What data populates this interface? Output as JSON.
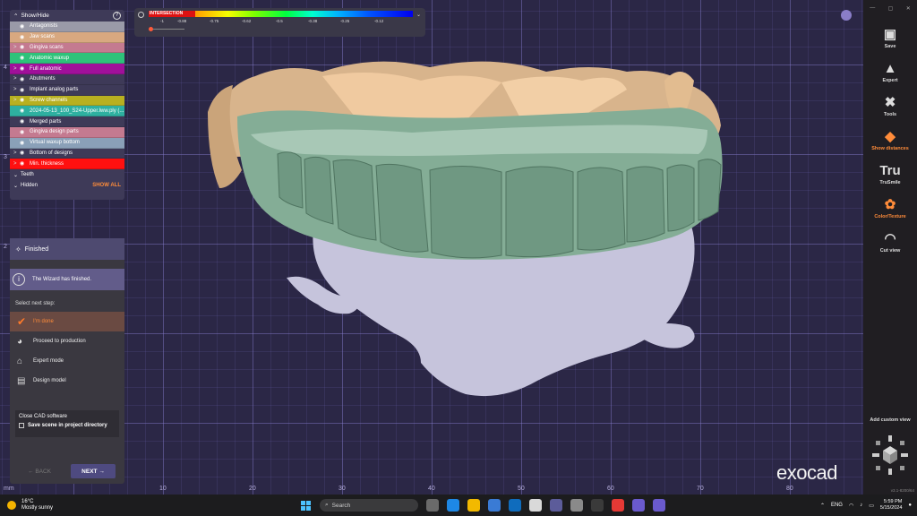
{
  "show_hide": {
    "title": "Show/Hide",
    "help": "?",
    "items": [
      {
        "label": "Antagonists",
        "color": "#9a9aa8",
        "chevron": ""
      },
      {
        "label": "Jaw scans",
        "color": "#d8a880",
        "chevron": ""
      },
      {
        "label": "Gingiva scans",
        "color": "#c47a90",
        "chevron": ">"
      },
      {
        "label": "Anatomic waxup",
        "color": "#2ec27a",
        "chevron": ""
      },
      {
        "label": "Full anatomic",
        "color": "#a0109a",
        "chevron": ">"
      },
      {
        "label": "Abutments",
        "color": "#3e3a58",
        "chevron": ">"
      },
      {
        "label": "Implant analog parts",
        "color": "#3e3a58",
        "chevron": ">"
      },
      {
        "label": "Screw channels",
        "color": "#b8b020",
        "chevron": ">"
      },
      {
        "label": "2024-05-13_100_S24-Upper.lww.ply (...",
        "color": "#2eb0a0",
        "chevron": ""
      },
      {
        "label": "Merged parts",
        "color": "#3e3a58",
        "chevron": ""
      },
      {
        "label": "Gingiva design parts",
        "color": "#c47a90",
        "chevron": ""
      },
      {
        "label": "Virtual waxup bottom",
        "color": "#8aa0b8",
        "chevron": ""
      },
      {
        "label": "Bottom of designs",
        "color": "#3e3a58",
        "chevron": ">"
      },
      {
        "label": "Min. thickness",
        "color": "#ff1010",
        "chevron": ">"
      }
    ],
    "teeth": "Teeth",
    "hidden": "Hidden",
    "show_all": "SHOW ALL"
  },
  "wizard": {
    "title": "Finished",
    "info": "The Wizard has finished.",
    "select_label": "Select next step:",
    "options": [
      {
        "label": "I'm done",
        "icon": "checkmark-icon"
      },
      {
        "label": "Proceed to production",
        "icon": "palette-icon"
      },
      {
        "label": "Expert mode",
        "icon": "graduation-cap-icon"
      },
      {
        "label": "Design model",
        "icon": "model-icon"
      }
    ],
    "close_label": "Close CAD software",
    "save_checkbox": "Save scene in project directory",
    "back": "BACK",
    "next": "NEXT"
  },
  "colorbar": {
    "label": "INTERSECTION",
    "ticks": [
      "-1",
      "-0.88",
      "-0.75",
      "-0.62",
      "-0.5",
      "-0.38",
      "-0.25",
      "-0.12"
    ]
  },
  "toolbar": {
    "items": [
      {
        "label": "Save",
        "icon": "save-icon",
        "active": false
      },
      {
        "label": "Expert",
        "icon": "expert-icon",
        "active": false
      },
      {
        "label": "Tools",
        "icon": "tools-icon",
        "active": false
      },
      {
        "label": "Show distances",
        "icon": "distances-icon",
        "active": true
      },
      {
        "label": "TruSmile",
        "icon": "trusmile-icon",
        "active": false
      },
      {
        "label": "Color/Texture",
        "icon": "color-texture-icon",
        "active": true
      },
      {
        "label": "Cut view",
        "icon": "cut-view-icon",
        "active": false
      }
    ],
    "add_custom_view": "Add custom view",
    "version": "v3.1-8200/64"
  },
  "logo": "exocad",
  "ruler": {
    "unit": "mm",
    "x": [
      "10",
      "20",
      "30",
      "40",
      "50",
      "60",
      "70",
      "80"
    ],
    "y": [
      "4",
      "3",
      "2"
    ]
  },
  "taskbar": {
    "temperature": "16°C",
    "weather": "Mostly sunny",
    "search": "Search",
    "language": "ENG",
    "time": "5:59 PM",
    "date": "5/15/2024"
  }
}
